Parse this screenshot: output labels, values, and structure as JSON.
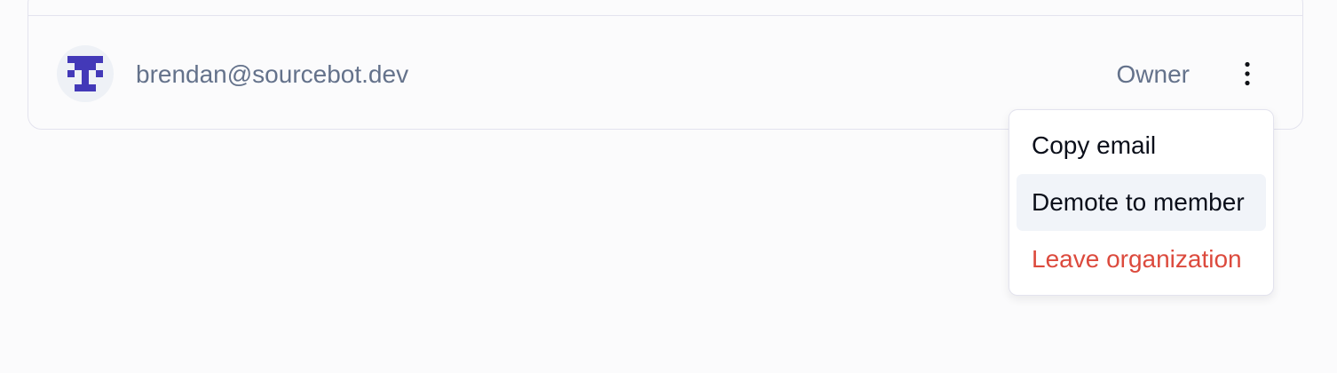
{
  "member": {
    "email": "brendan@sourcebot.dev",
    "role": "Owner",
    "avatar_icon": "identicon-avatar",
    "avatar_color": "#4339b8"
  },
  "actions_button": {
    "icon": "more-vertical-icon"
  },
  "menu": {
    "copy_email": "Copy email",
    "demote": "Demote to member",
    "leave": "Leave organization",
    "highlighted_item": "Demote to member",
    "danger_color": "#dc4a3d"
  }
}
